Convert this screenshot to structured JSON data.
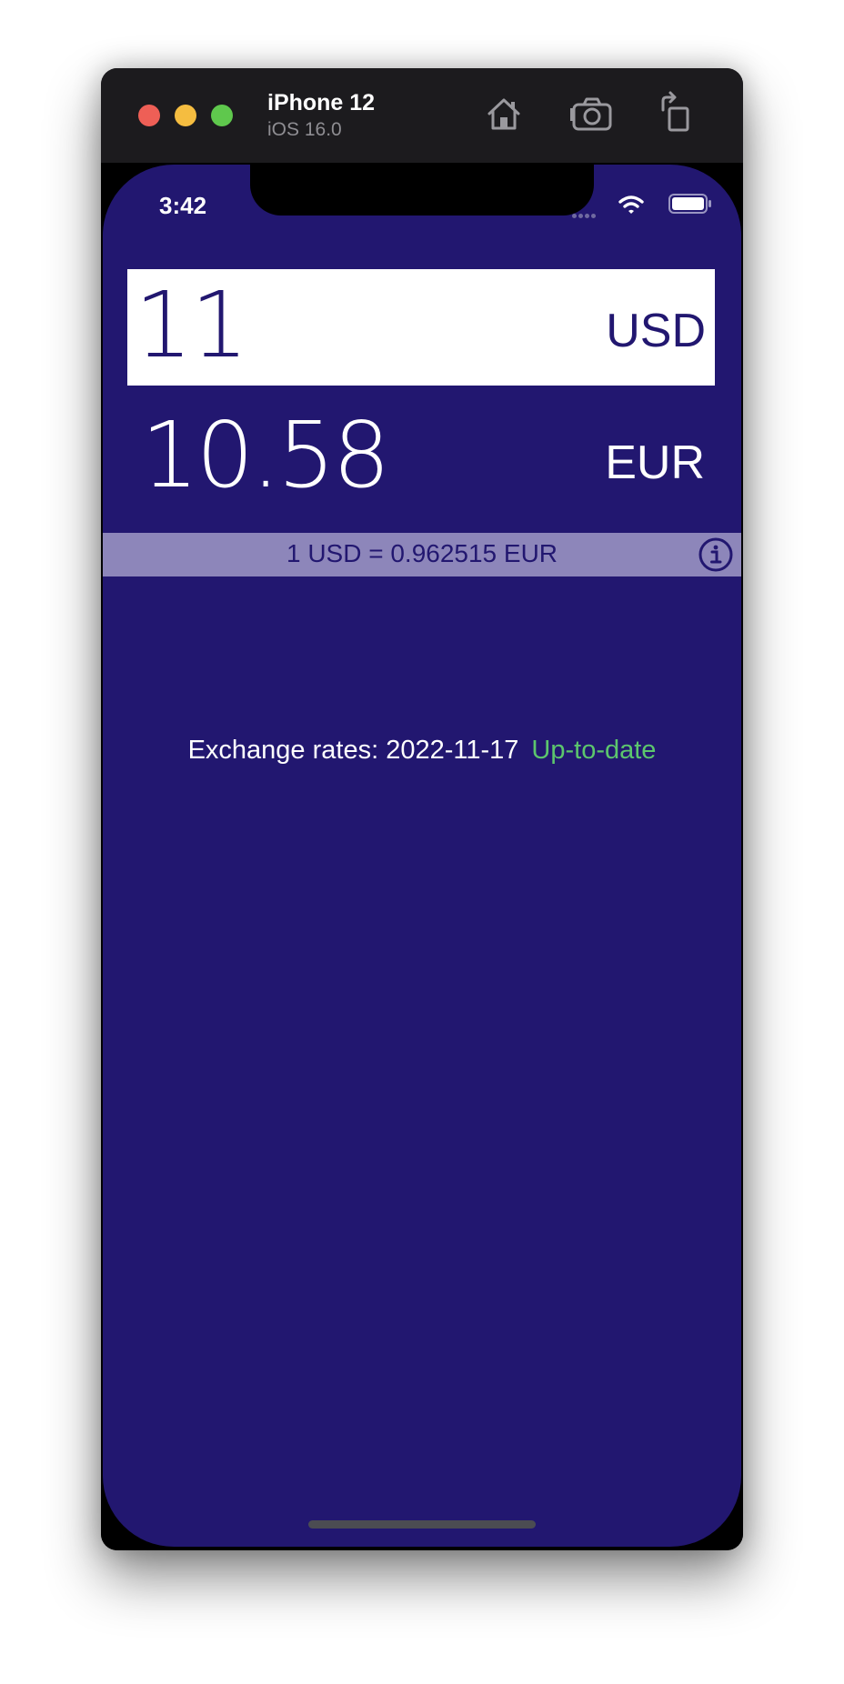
{
  "simulator": {
    "device_name": "iPhone 12",
    "os_version": "iOS 16.0",
    "toolbar_icons": [
      "home-icon",
      "camera-icon",
      "rotate-icon"
    ]
  },
  "status_bar": {
    "time": "3:42",
    "icons": [
      "signal-dots-icon",
      "wifi-icon",
      "battery-icon"
    ]
  },
  "converter": {
    "input_amount": "11",
    "input_currency": "USD",
    "output_amount": "10.58",
    "output_currency": "EUR",
    "rate_text": "1 USD = 0.962515 EUR"
  },
  "footer": {
    "rates_label": "Exchange rates: 2022-11-17",
    "rates_status": "Up-to-date"
  },
  "colors": {
    "background": "#221770",
    "rate_bar": "#8d86ba",
    "status_ok": "#5cc66d",
    "text_on_white": "#221770"
  }
}
